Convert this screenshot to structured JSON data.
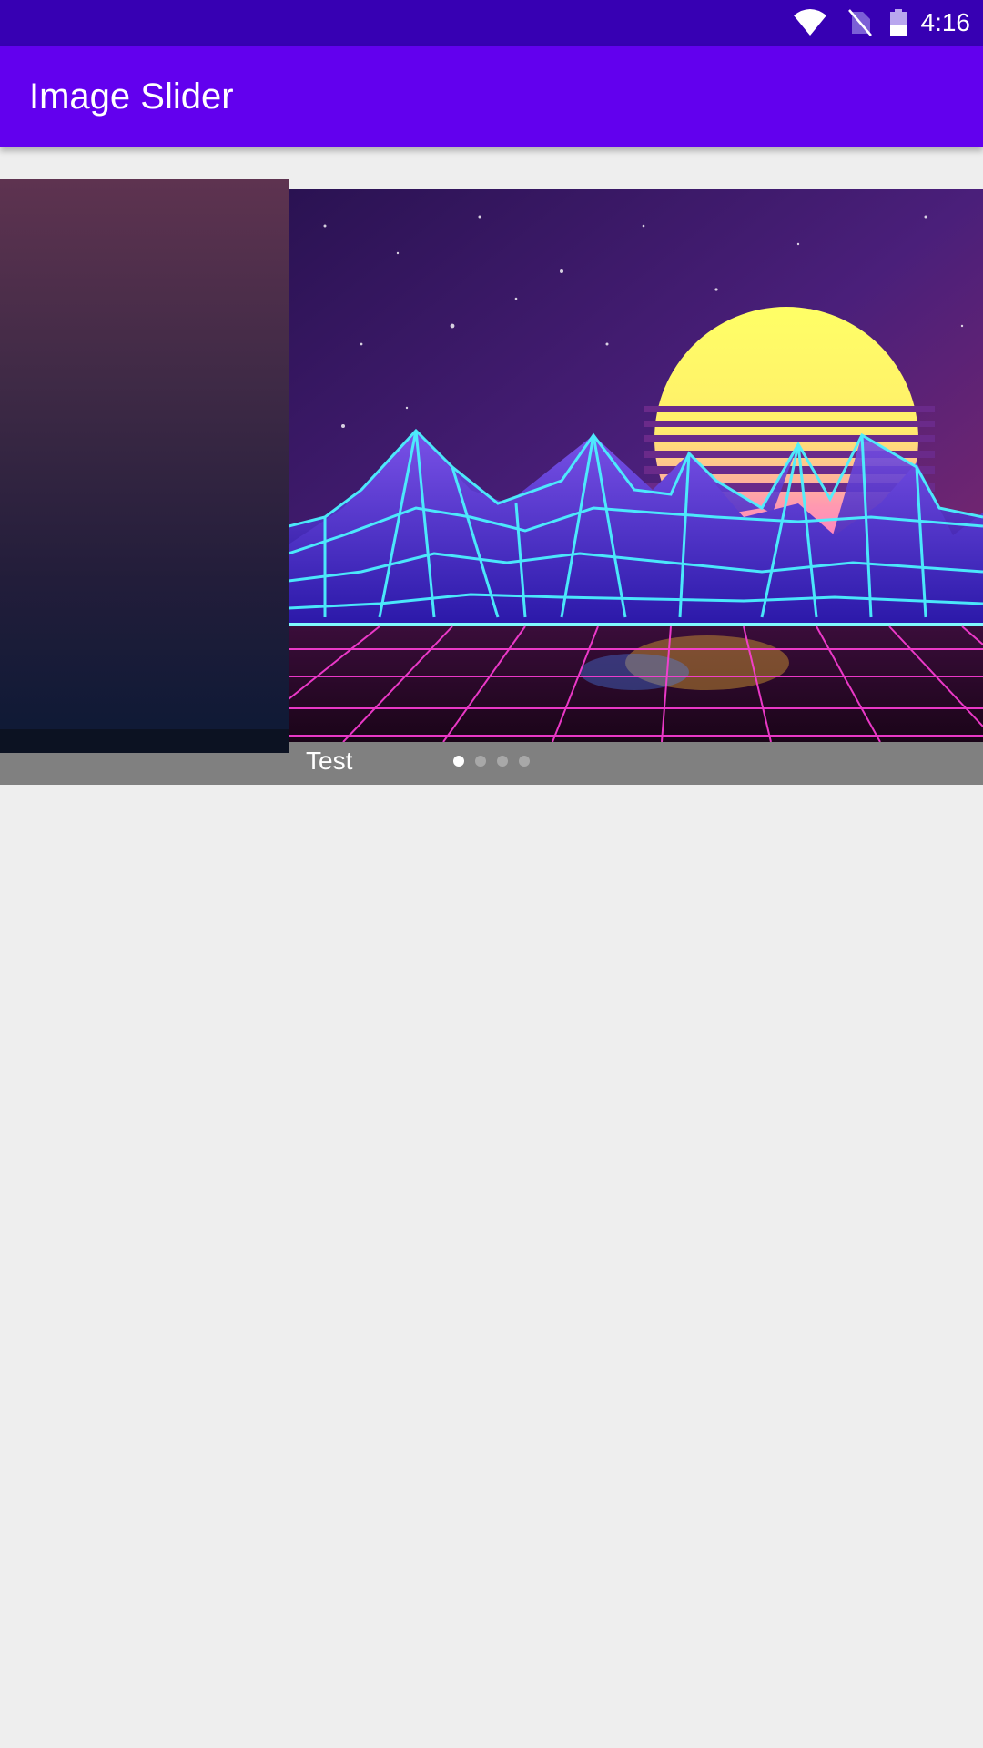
{
  "status_bar": {
    "time": "4:16",
    "icons": [
      "wifi-icon",
      "no-sim-icon",
      "battery-icon"
    ],
    "background": "#3700b3"
  },
  "app_bar": {
    "title": "Image Slider",
    "background": "#6200ee"
  },
  "slider": {
    "caption": "Test",
    "slide_count": 4,
    "active_index": 0,
    "current_image": "synthwave-landscape-image",
    "caption_background": "#808080"
  },
  "colors": {
    "page_background": "#eeeeee",
    "dot_active": "#ffffff",
    "dot_inactive": "#a8a8a8"
  }
}
